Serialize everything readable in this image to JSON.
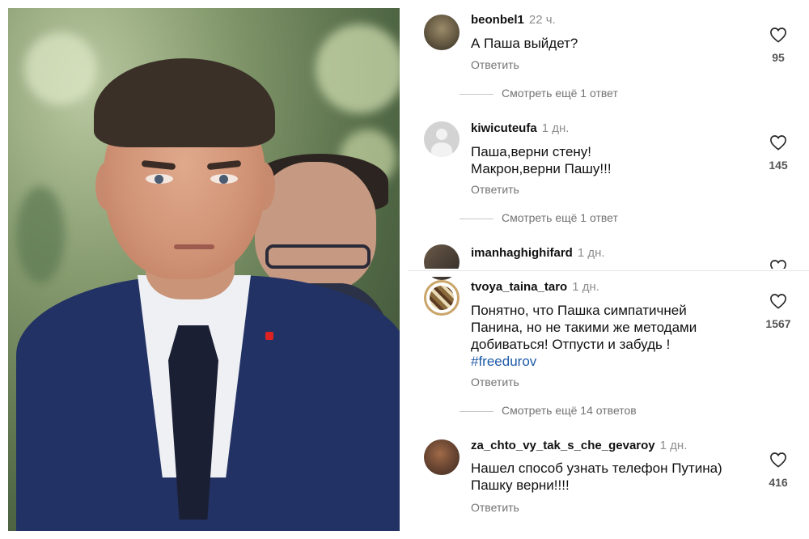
{
  "comments": [
    {
      "username": "beonbel1",
      "time": "22 ч.",
      "text": "А Паша выйдет?",
      "reply_label": "Ответить",
      "likes": "95",
      "more_replies": "Смотреть ещё 1 ответ"
    },
    {
      "username": "kiwicuteufa",
      "time": "1 дн.",
      "text_lines": [
        "Паша,верни стену!",
        "Макрон,верни Пашу!!!"
      ],
      "reply_label": "Ответить",
      "likes": "145",
      "more_replies": "Смотреть ещё 1 ответ"
    },
    {
      "username": "imanhaghighifard",
      "time": "1 дн."
    },
    {
      "username": "tvoya_taina_taro",
      "time": "1 дн.",
      "text_lines": [
        "Понятно, что Пашка симпатичней",
        "Панина, но не такими же методами",
        "добиваться! Отпусти и забудь !"
      ],
      "hashtag": "#freedurov",
      "reply_label": "Ответить",
      "likes": "1567",
      "more_replies": "Смотреть ещё 14 ответов"
    },
    {
      "username": "za_chto_vy_tak_s_che_gevaroy",
      "time": "1 дн.",
      "text_lines": [
        "Нашел способ узнать телефон Путина)",
        "Пашку верни!!!!"
      ],
      "reply_label": "Ответить",
      "likes": "416"
    }
  ],
  "icons": {
    "like": "heart-outline-icon",
    "avatar_placeholder": "default-user-icon"
  },
  "colors": {
    "hashtag": "#1e5aa8",
    "meta_text": "#737373",
    "heart_stroke": "#262626"
  }
}
